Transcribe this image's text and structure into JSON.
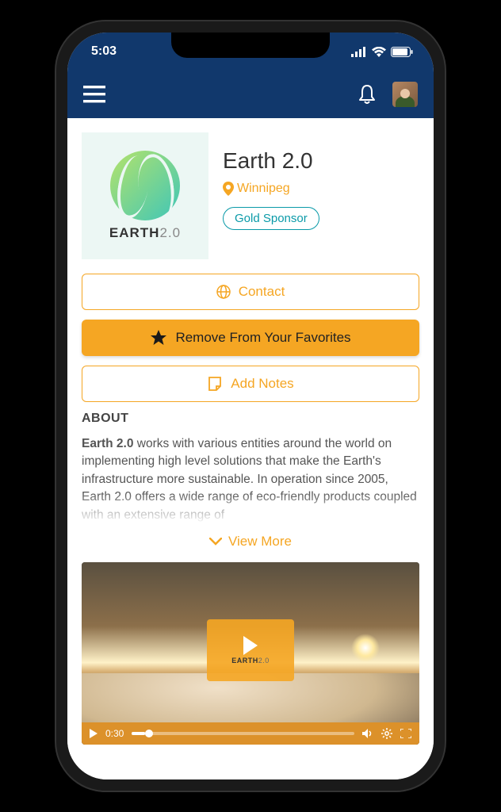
{
  "status": {
    "time": "5:03"
  },
  "profile": {
    "name": "Earth 2.0",
    "logo_label": "EARTH",
    "logo_sub": "2.0",
    "location": "Winnipeg",
    "badge": "Gold Sponsor"
  },
  "actions": {
    "contact": "Contact",
    "remove_fav": "Remove From Your Favorites",
    "add_notes": "Add Notes"
  },
  "about": {
    "heading": "ABOUT",
    "bold_lead": "Earth 2.0",
    "text": " works with various entities around the world on implementing high level solutions that make the Earth's infrastructure more sustainable. In operation since 2005, Earth 2.0 offers a wide range of eco-friendly products coupled with an extensive range of",
    "view_more": "View More"
  },
  "video": {
    "current_time": "0:30",
    "badge_label": "EARTH",
    "badge_sub": "2.0"
  }
}
